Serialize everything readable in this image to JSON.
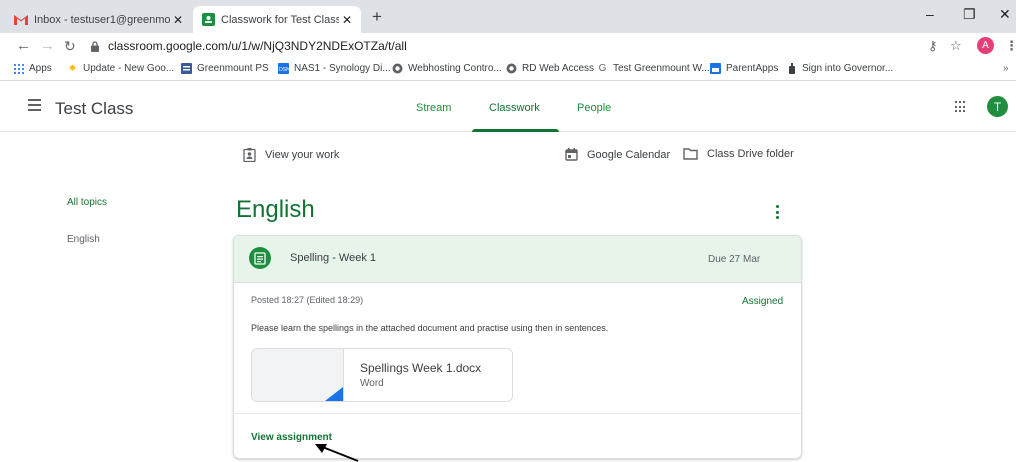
{
  "browser": {
    "tabs": [
      {
        "title": "Inbox - testuser1@greenmount.s",
        "icon": "gmail-icon",
        "active": false
      },
      {
        "title": "Classwork for Test Class",
        "icon": "classroom-icon",
        "active": true
      }
    ],
    "new_tab_label": "+",
    "window_controls": {
      "minimize": "–",
      "restore": "❐",
      "close": "✕"
    },
    "url": "classroom.google.com/u/1/w/NjQ3NDY2NDExOTZa/t/all",
    "profile_initial": "A",
    "bookmarks": [
      {
        "label": "Apps",
        "icon": "apps-grid-icon"
      },
      {
        "label": "Update - New Goo...",
        "icon": "update-icon"
      },
      {
        "label": "Greenmount PS",
        "icon": "school-icon"
      },
      {
        "label": "NAS1 - Synology Di...",
        "icon": "synology-icon"
      },
      {
        "label": "Webhosting Contro...",
        "icon": "globe-icon"
      },
      {
        "label": "RD Web Access",
        "icon": "globe-icon"
      },
      {
        "label": "Test Greenmount W...",
        "icon": "google-icon"
      },
      {
        "label": "ParentApps",
        "icon": "parentapps-icon"
      },
      {
        "label": "Sign into Governor...",
        "icon": "governor-icon"
      }
    ],
    "bookmarks_more": "»"
  },
  "classroom": {
    "class_name": "Test Class",
    "nav": [
      {
        "label": "Stream",
        "active": false
      },
      {
        "label": "Classwork",
        "active": true
      },
      {
        "label": "People",
        "active": false
      }
    ],
    "user_initial": "T",
    "actions": {
      "view_work": "View your work",
      "calendar": "Google Calendar",
      "drive": "Class Drive folder"
    },
    "topics": {
      "all": "All topics",
      "items": [
        "English"
      ]
    },
    "topic_heading": "English",
    "assignment": {
      "title": "Spelling - Week 1",
      "due": "Due 27 Mar",
      "posted": "Posted 18:27 (Edited 18:29)",
      "status": "Assigned",
      "instructions": "Please learn the spellings in the attached document and practise using then in sentences.",
      "attachment": {
        "name": "Spellings Week 1.docx",
        "type": "Word"
      },
      "view_link": "View assignment"
    }
  },
  "colors": {
    "classroom_green": "#137333",
    "header_green_bg": "#e6f4ea",
    "tab_strip": "#dee1e6"
  }
}
